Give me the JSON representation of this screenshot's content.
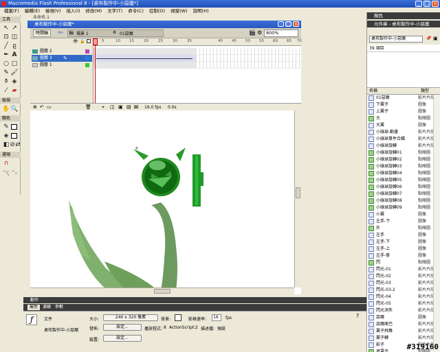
{
  "app": {
    "title": "Macromedia Flash Professional 8 - [桌布製作中-小惡魔*]",
    "colors": {
      "titlebar": "#1f4fb5",
      "selection": "#316ac5",
      "panelHeader": "#3b3b3b"
    }
  },
  "menu": [
    "檔案(F)",
    "編輯(E)",
    "檢視(V)",
    "插入(I)",
    "修改(M)",
    "文字(T)",
    "命令(C)",
    "控制(O)",
    "視窗(W)",
    "說明(H)"
  ],
  "tools": {
    "title": "工具",
    "view": "檢視",
    "colors": "顏色",
    "options": "選項"
  },
  "doc": {
    "tab": "未命名-1",
    "title": "桌布製作中-小惡魔*",
    "timeline_btn": "時間軸",
    "scene": "場景 1",
    "symbol": "01惡魔",
    "zoom": "800%",
    "layers": [
      {
        "name": "圖層 2"
      },
      {
        "name": "圖層 3"
      },
      {
        "name": "圖層 1"
      }
    ],
    "ruler": [
      "5",
      "10",
      "15",
      "20",
      "25",
      "30",
      "35",
      "40",
      "45",
      "50",
      "55",
      "60",
      "65",
      "70"
    ],
    "frame": "1",
    "fps": "16.0 fps",
    "time": "0.0s"
  },
  "library": {
    "colors_panel": "顏色",
    "library_panel": "元件庫 - 桌布製作中-小惡魔",
    "file_select": "桌布製作中-小惡魔",
    "count": "39 項目",
    "col_name": "名稱",
    "col_type": "類型",
    "items": [
      {
        "name": "01惡魔",
        "type": "影片片段",
        "kind": "sym"
      },
      {
        "name": "下翼子",
        "type": "圖像",
        "kind": "sym"
      },
      {
        "name": "上翼子",
        "type": "圖像",
        "kind": "sym"
      },
      {
        "name": "大",
        "type": "點陣圖",
        "kind": "bmp"
      },
      {
        "name": "大翼",
        "type": "圖像",
        "kind": "sym"
      },
      {
        "name": "小綠球-動畫",
        "type": "影片片段",
        "kind": "sym"
      },
      {
        "name": "小綠球事件合輯",
        "type": "影片片段",
        "kind": "sym"
      },
      {
        "name": "小綠球旋轉",
        "type": "影片片段",
        "kind": "sym"
      },
      {
        "name": "小綠球旋轉01",
        "type": "點陣圖",
        "kind": "bmp"
      },
      {
        "name": "小綠球旋轉02",
        "type": "點陣圖",
        "kind": "bmp"
      },
      {
        "name": "小綠球旋轉03",
        "type": "點陣圖",
        "kind": "bmp"
      },
      {
        "name": "小綠球旋轉04",
        "type": "點陣圖",
        "kind": "bmp"
      },
      {
        "name": "小綠球旋轉05",
        "type": "點陣圖",
        "kind": "bmp"
      },
      {
        "name": "小綠球旋轉06",
        "type": "點陣圖",
        "kind": "bmp"
      },
      {
        "name": "小綠球旋轉07",
        "type": "點陣圖",
        "kind": "bmp"
      },
      {
        "name": "小綠球旋轉08",
        "type": "點陣圖",
        "kind": "bmp"
      },
      {
        "name": "小綠球旋轉09",
        "type": "點陣圖",
        "kind": "bmp"
      },
      {
        "name": "小翼",
        "type": "圖像",
        "kind": "sym"
      },
      {
        "name": "左手-下",
        "type": "圖像",
        "kind": "sym"
      },
      {
        "name": "外",
        "type": "點陣圖",
        "kind": "bmp"
      },
      {
        "name": "左手",
        "type": "圖像",
        "kind": "sym"
      },
      {
        "name": "左手-下",
        "type": "圖像",
        "kind": "sym"
      },
      {
        "name": "左手-上",
        "type": "圖像",
        "kind": "sym"
      },
      {
        "name": "左手-拳",
        "type": "圖像",
        "kind": "sym"
      },
      {
        "name": "閃",
        "type": "點陣圖",
        "kind": "bmp"
      },
      {
        "name": "閃光-01",
        "type": "影片片段",
        "kind": "sym"
      },
      {
        "name": "閃光-02",
        "type": "影片片段",
        "kind": "sym"
      },
      {
        "name": "閃光-03",
        "type": "影片片段",
        "kind": "sym"
      },
      {
        "name": "閃光-03-2",
        "type": "影片片段",
        "kind": "sym"
      },
      {
        "name": "閃光-04",
        "type": "影片片段",
        "kind": "sym"
      },
      {
        "name": "閃光-05",
        "type": "影片片段",
        "kind": "sym"
      },
      {
        "name": "閃光消失",
        "type": "影片片段",
        "kind": "sym"
      },
      {
        "name": "惡魔",
        "type": "圖像",
        "kind": "sym"
      },
      {
        "name": "惡魔尾巴",
        "type": "影片片段",
        "kind": "sym"
      },
      {
        "name": "翼子飛舞",
        "type": "影片片段",
        "kind": "sym"
      },
      {
        "name": "翼子轉",
        "type": "影片片段",
        "kind": "sym"
      },
      {
        "name": "影子",
        "type": "影片片段",
        "kind": "sym"
      },
      {
        "name": "遮罩子",
        "type": "點陣圖",
        "kind": "bmp"
      }
    ]
  },
  "bottom": {
    "actions": "動作",
    "tabs": [
      "屬性",
      "濾鏡",
      "參數"
    ],
    "doc_label": "文件",
    "doc_name": "桌布製作中-小惡魔",
    "size_label": "大小:",
    "size_value": "240 x 320 像素",
    "bg_label": "背景:",
    "fps_label": "影格速率:",
    "fps_value": "16",
    "fps_unit": "fps",
    "publish_label": "發佈:",
    "settings": "設定...",
    "player_label": "播放程式:",
    "player_value": "8",
    "as_label": "ActionScript:",
    "as_value": "2",
    "profile_label": "描述檔:",
    "profile_value": "預設",
    "device_label": "裝置:",
    "device_settings": "設定..."
  },
  "watermark": "#319160"
}
